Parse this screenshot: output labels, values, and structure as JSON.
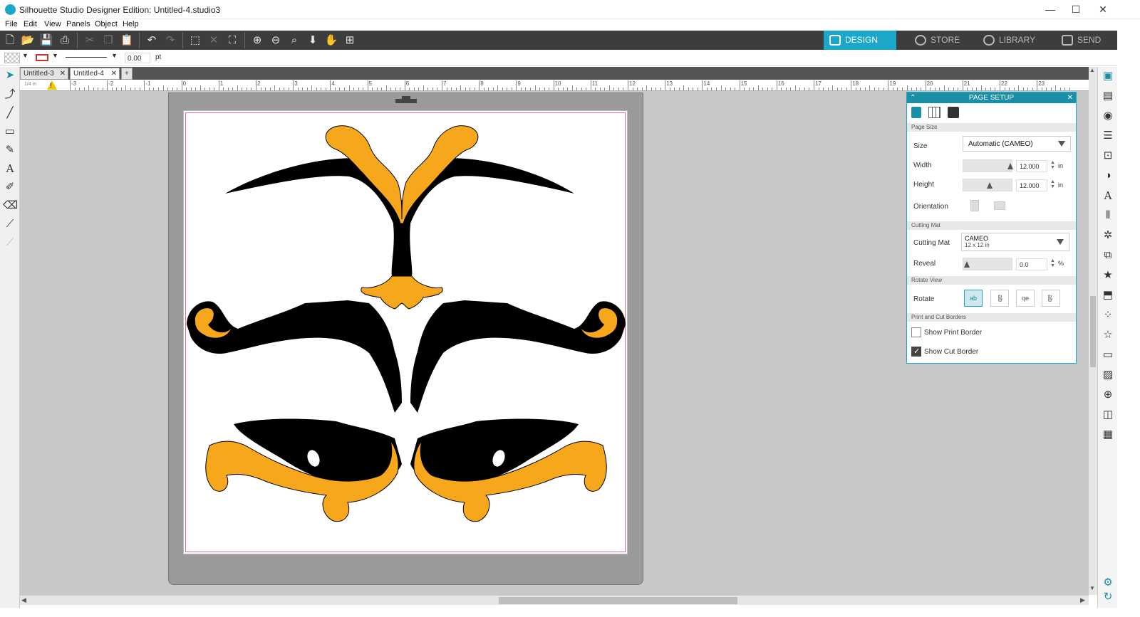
{
  "window": {
    "title": "Silhouette Studio Designer Edition: Untitled-4.studio3",
    "minimize": "—",
    "maximize": "☐",
    "close": "✕"
  },
  "menu": [
    "File",
    "Edit",
    "View",
    "Panels",
    "Object",
    "Help"
  ],
  "nav_tabs": [
    {
      "label": "DESIGN",
      "active": true
    },
    {
      "label": "STORE",
      "active": false
    },
    {
      "label": "LIBRARY",
      "active": false
    },
    {
      "label": "SEND",
      "active": false
    }
  ],
  "properties_bar": {
    "line_width": "0.00",
    "line_unit": "pt"
  },
  "document_tabs": [
    {
      "label": "Untitled-3",
      "active": false
    },
    {
      "label": "Untitled-4",
      "active": true
    }
  ],
  "add_tab": "+",
  "ruler": {
    "labels": [
      "-3",
      "-2",
      "-1",
      "0",
      "1",
      "2",
      "3",
      "4",
      "5",
      "6",
      "7",
      "8",
      "9",
      "10",
      "11",
      "12",
      "13",
      "14",
      "15",
      "16",
      "17",
      "18",
      "19",
      "20",
      "21",
      "22",
      "23"
    ],
    "corner": "1/4 in",
    "warning": "!"
  },
  "page_setup": {
    "title": "PAGE SETUP",
    "sections": {
      "page_size": "Page Size",
      "cutting_mat": "Cutting Mat",
      "rotate_view": "Rotate View",
      "print_cut_borders": "Print and Cut Borders"
    },
    "size_label": "Size",
    "size_value": "Automatic (CAMEO)",
    "width_label": "Width",
    "width_value": "12.000",
    "height_label": "Height",
    "height_value": "12.000",
    "unit": "in",
    "orientation_label": "Orientation",
    "cutting_mat_label": "Cutting Mat",
    "cutting_mat_value": "CAMEO",
    "cutting_mat_sub": "12 x 12 in",
    "reveal_label": "Reveal",
    "reveal_value": "0.0",
    "reveal_unit": "%",
    "rotate_label": "Rotate",
    "rotate_options": [
      "ab",
      "ab",
      "qe",
      "ab"
    ],
    "show_print_border": {
      "label": "Show Print Border",
      "checked": false
    },
    "show_cut_border": {
      "label": "Show Cut Border",
      "checked": true
    }
  },
  "colors": {
    "accent": "#1aa7c9",
    "toolbar": "#3d3d3d",
    "orange": "#f6a71b",
    "black_shape": "#000000",
    "canvas": "#c8c8c8",
    "mat": "#9a9a9a"
  }
}
